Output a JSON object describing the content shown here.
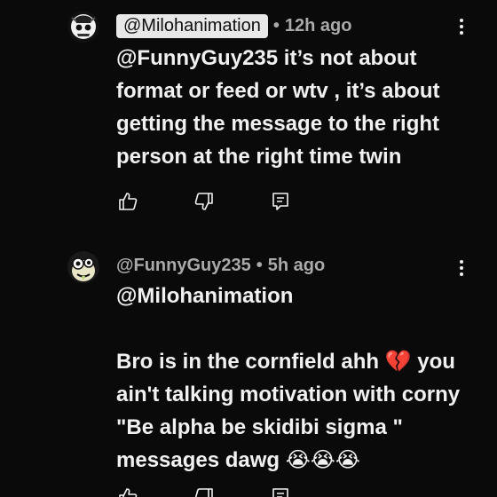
{
  "comments": [
    {
      "author": "@Milohanimation",
      "separator": "•",
      "time": "12h ago",
      "text": "@FunnyGuy235 it’s not about format or feed or wtv , it’s about getting the message to the right person at the right time twin",
      "avatar_icon": "skull-logo-avatar",
      "author_highlighted": true
    },
    {
      "author": "@FunnyGuy235",
      "separator": "•",
      "time": "5h ago",
      "text": "@Milohanimation\n\nBro is in the cornfield ahh 💔 you ain't talking motivation with corny \"Be alpha be skidibi sigma \" messages dawg 😭😭😭",
      "avatar_icon": "cartoon-face-avatar",
      "author_highlighted": false
    }
  ],
  "icons": {
    "like": "thumbs-up-icon",
    "dislike": "thumbs-down-icon",
    "reply": "reply-comment-icon",
    "more": "more-vertical-icon"
  },
  "colors": {
    "background": "#0a0a0a",
    "text": "#f1f1f1",
    "muted": "#aaaaaa",
    "chip": "#e8e8e8"
  }
}
